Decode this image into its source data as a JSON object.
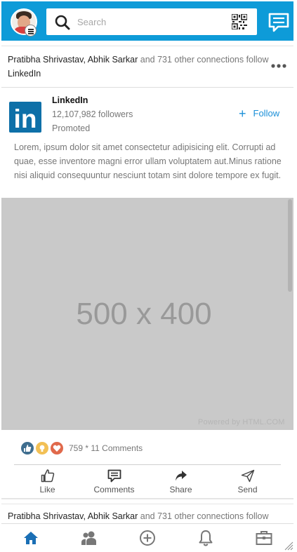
{
  "header": {
    "search_placeholder": "Search",
    "brand_color": "#0E9BD8"
  },
  "post": {
    "social_names": "Pratibha Shrivastav, Abhik Sarkar",
    "social_suffix": "and 731 other connections follow",
    "social_company": "LinkedIn",
    "company": "LinkedIn",
    "logo_text": "in",
    "followers": "12,107,982 followers",
    "promoted": "Promoted",
    "follow_label": "Follow",
    "body": "Lorem, ipsum dolor sit amet consectetur adipisicing elit. Corrupti ad quae, esse inventore magni error ullam voluptatem aut.Minus ratione nisi aliquid consequuntur nesciunt totam sint dolore tempore ex fugit.",
    "image_label": "500 x 400",
    "image_credit": "Powered by HTML.COM",
    "reactions_count": "759 * 11 Comments",
    "actions": [
      "Like",
      "Comments",
      "Share",
      "Send"
    ]
  },
  "next_post": {
    "social_names": "Pratibha Shrivastav, Abhik Sarkar",
    "social_suffix": "and 731 other connections follow"
  },
  "bottom_nav": {
    "items": [
      "home-icon",
      "network-icon",
      "post-icon",
      "notifications-icon",
      "jobs-icon"
    ],
    "active_color": "#1A6FB5"
  }
}
